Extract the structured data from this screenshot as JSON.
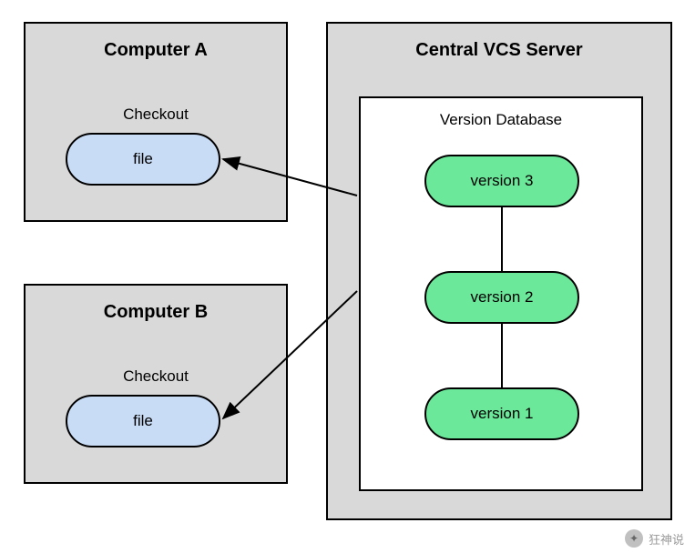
{
  "computerA": {
    "title": "Computer A",
    "checkout_label": "Checkout",
    "file_label": "file"
  },
  "computerB": {
    "title": "Computer B",
    "checkout_label": "Checkout",
    "file_label": "file"
  },
  "server": {
    "title": "Central VCS Server",
    "database": {
      "title": "Version Database",
      "versions": {
        "v3": "version 3",
        "v2": "version 2",
        "v1": "version 1"
      }
    }
  },
  "watermark": {
    "text": "狂神说"
  }
}
